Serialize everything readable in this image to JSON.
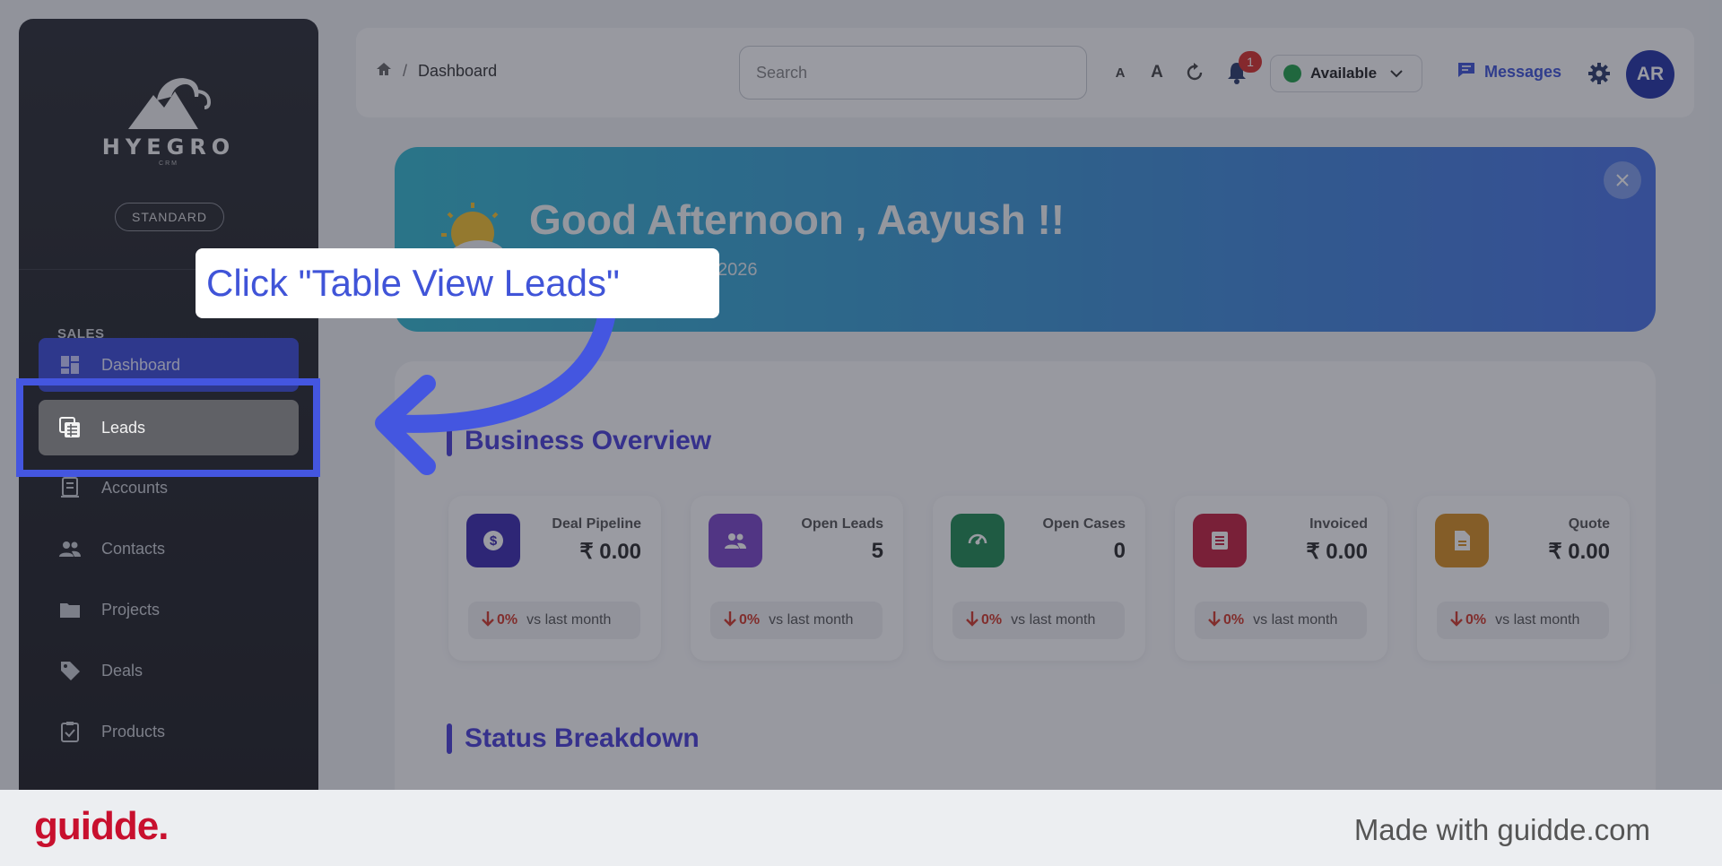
{
  "sidebar": {
    "logo_word": "HYEGRO",
    "logo_sub": "CRM",
    "plan": "STANDARD",
    "section": "SALES",
    "items": [
      {
        "label": "Dashboard",
        "icon": "dashboard-icon"
      },
      {
        "label": "Leads",
        "icon": "leads-icon"
      },
      {
        "label": "Accounts",
        "icon": "accounts-icon"
      },
      {
        "label": "Contacts",
        "icon": "contacts-icon"
      },
      {
        "label": "Projects",
        "icon": "folder-icon"
      },
      {
        "label": "Deals",
        "icon": "tag-icon"
      },
      {
        "label": "Products",
        "icon": "clipboard-icon"
      }
    ]
  },
  "header": {
    "breadcrumb": "Dashboard",
    "search_placeholder": "Search",
    "font_small": "A",
    "font_large": "A",
    "notification_count": "1",
    "status": "Available",
    "messages": "Messages",
    "avatar": "AR"
  },
  "banner": {
    "greeting": "Good Afternoon , Aayush !!",
    "date": "2026"
  },
  "overview": {
    "title": "Business Overview",
    "cards": [
      {
        "label": "Deal Pipeline",
        "value": "₹ 0.00",
        "pct": "0%",
        "trend": "vs last month",
        "color": "#3b2ab0"
      },
      {
        "label": "Open Leads",
        "value": "5",
        "pct": "0%",
        "trend": "vs last month",
        "color": "#7b45c9"
      },
      {
        "label": "Open Cases",
        "value": "0",
        "pct": "0%",
        "trend": "vs last month",
        "color": "#1f8a52"
      },
      {
        "label": "Invoiced",
        "value": "₹ 0.00",
        "pct": "0%",
        "trend": "vs last month",
        "color": "#c4203f"
      },
      {
        "label": "Quote",
        "value": "₹ 0.00",
        "pct": "0%",
        "trend": "vs last month",
        "color": "#d88f22"
      }
    ]
  },
  "status": {
    "title": "Status Breakdown"
  },
  "tutorial": {
    "instruction": "Click \"Table View Leads\"",
    "accent": "#4456e0"
  },
  "footer": {
    "brand": "guidde.",
    "made_with": "Made with guidde.com"
  }
}
